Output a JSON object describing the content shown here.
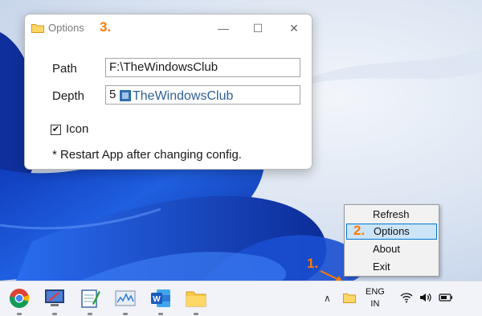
{
  "window": {
    "title": "Options",
    "step_label": "3.",
    "path_label": "Path",
    "path_value": "F:\\TheWindowsClub",
    "depth_label": "Depth",
    "depth_value": "5",
    "watermark": "TheWindowsClub",
    "icon_checkbox_label": "Icon",
    "icon_checked": true,
    "note": "* Restart App after changing config.",
    "minimize_glyph": "—",
    "maximize_glyph": "☐",
    "close_glyph": "✕"
  },
  "context_menu": {
    "items": [
      "Refresh",
      "Options",
      "About",
      "Exit"
    ],
    "highlighted": "Options",
    "step_label": "2."
  },
  "tray": {
    "step_label": "1.",
    "chevron_glyph": "∧",
    "language_line1": "ENG",
    "language_line2": "IN"
  },
  "taskbar": {
    "apps": [
      "chrome-icon",
      "remote-desktop-icon",
      "notepad-icon",
      "performance-monitor-icon",
      "word-icon",
      "file-explorer-icon"
    ]
  },
  "colors": {
    "accent_orange": "#ff7a00",
    "menu_highlight": "#cce4f7",
    "menu_highlight_border": "#0078d4",
    "wallpaper_blue": "#1a4fd0"
  }
}
